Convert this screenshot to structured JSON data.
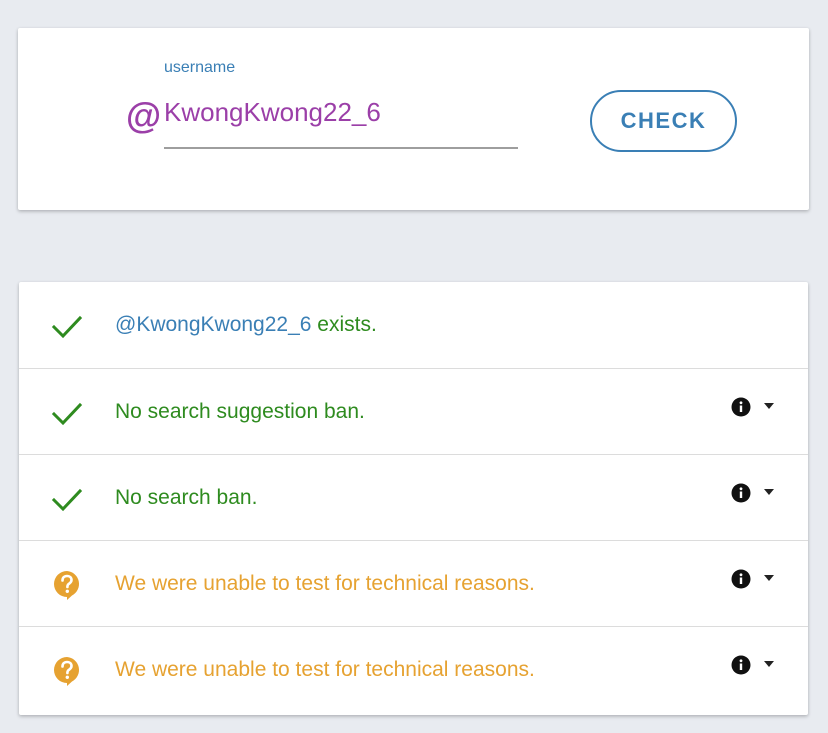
{
  "lookup": {
    "field_label": "username",
    "at_symbol": "@",
    "username_value": "KwongKwong22_6",
    "check_button_label": "CHECK"
  },
  "results": {
    "rows": [
      {
        "status": "ok",
        "icon": "check-icon",
        "handle": "@KwongKwong22_6",
        "message": " exists.",
        "has_info": false
      },
      {
        "status": "ok",
        "icon": "check-icon",
        "message": "No search suggestion ban.",
        "has_info": true
      },
      {
        "status": "ok",
        "icon": "check-icon",
        "message": "No search ban.",
        "has_info": true
      },
      {
        "status": "unknown",
        "icon": "question-bubble-icon",
        "message": "We were unable to test for technical reasons.",
        "has_info": true
      },
      {
        "status": "unknown",
        "icon": "question-bubble-icon",
        "message": "We were unable to test for technical reasons.",
        "has_info": true
      }
    ]
  },
  "colors": {
    "accent_purple": "#9b3fa8",
    "accent_blue": "#3a7fb5",
    "status_green": "#2e8b1f",
    "status_orange": "#e6a231",
    "background": "#e8ebf0"
  }
}
